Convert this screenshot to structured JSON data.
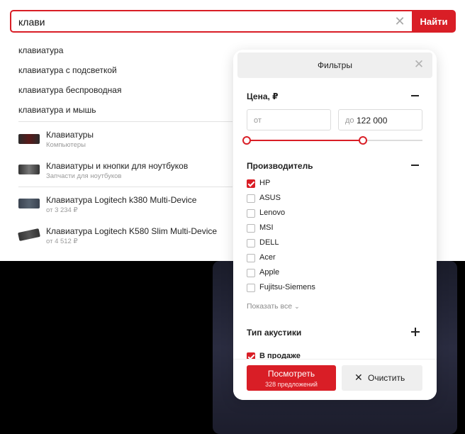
{
  "search": {
    "value": "клави",
    "button_label": "Найти"
  },
  "suggestions": [
    "клавиатура",
    "клавиатура с подсветкой",
    "клавиатура беспроводная",
    "клавиатура и мышь"
  ],
  "categories": [
    {
      "title": "Клавиатуры",
      "subtitle": "Компьютеры"
    },
    {
      "title": "Клавиатуры и кнопки для ноутбуков",
      "subtitle": "Запчасти для ноутбуков"
    }
  ],
  "products": [
    {
      "title": "Клавиатура Logitech k380 Multi-Device",
      "price": "от 3 234 ₽"
    },
    {
      "title": "Клавиатура Logitech K580 Slim Multi-Device",
      "price": "от 4 512 ₽"
    }
  ],
  "filters": {
    "title": "Фильтры",
    "price": {
      "title": "Цена, ₽",
      "from_label": "от",
      "to_label": "до",
      "to_value": "122 000",
      "range_fraction": [
        0.0,
        0.66
      ]
    },
    "manufacturer": {
      "title": "Производитель",
      "options": [
        {
          "label": "HP",
          "checked": true
        },
        {
          "label": "ASUS",
          "checked": false
        },
        {
          "label": "Lenovo",
          "checked": false
        },
        {
          "label": "MSI",
          "checked": false
        },
        {
          "label": "DELL",
          "checked": false
        },
        {
          "label": "Acer",
          "checked": false
        },
        {
          "label": "Apple",
          "checked": false
        },
        {
          "label": "Fujitsu-Siemens",
          "checked": false
        }
      ],
      "show_all_label": "Показать все"
    },
    "acoustics_title": "Тип акустики",
    "in_stock": {
      "label": "В продаже",
      "checked": true
    },
    "view_button": {
      "title": "Посмотреть",
      "subtitle": "328 предложений"
    },
    "clear_button_label": "Очистить"
  },
  "colors": {
    "accent": "#d91e26"
  }
}
